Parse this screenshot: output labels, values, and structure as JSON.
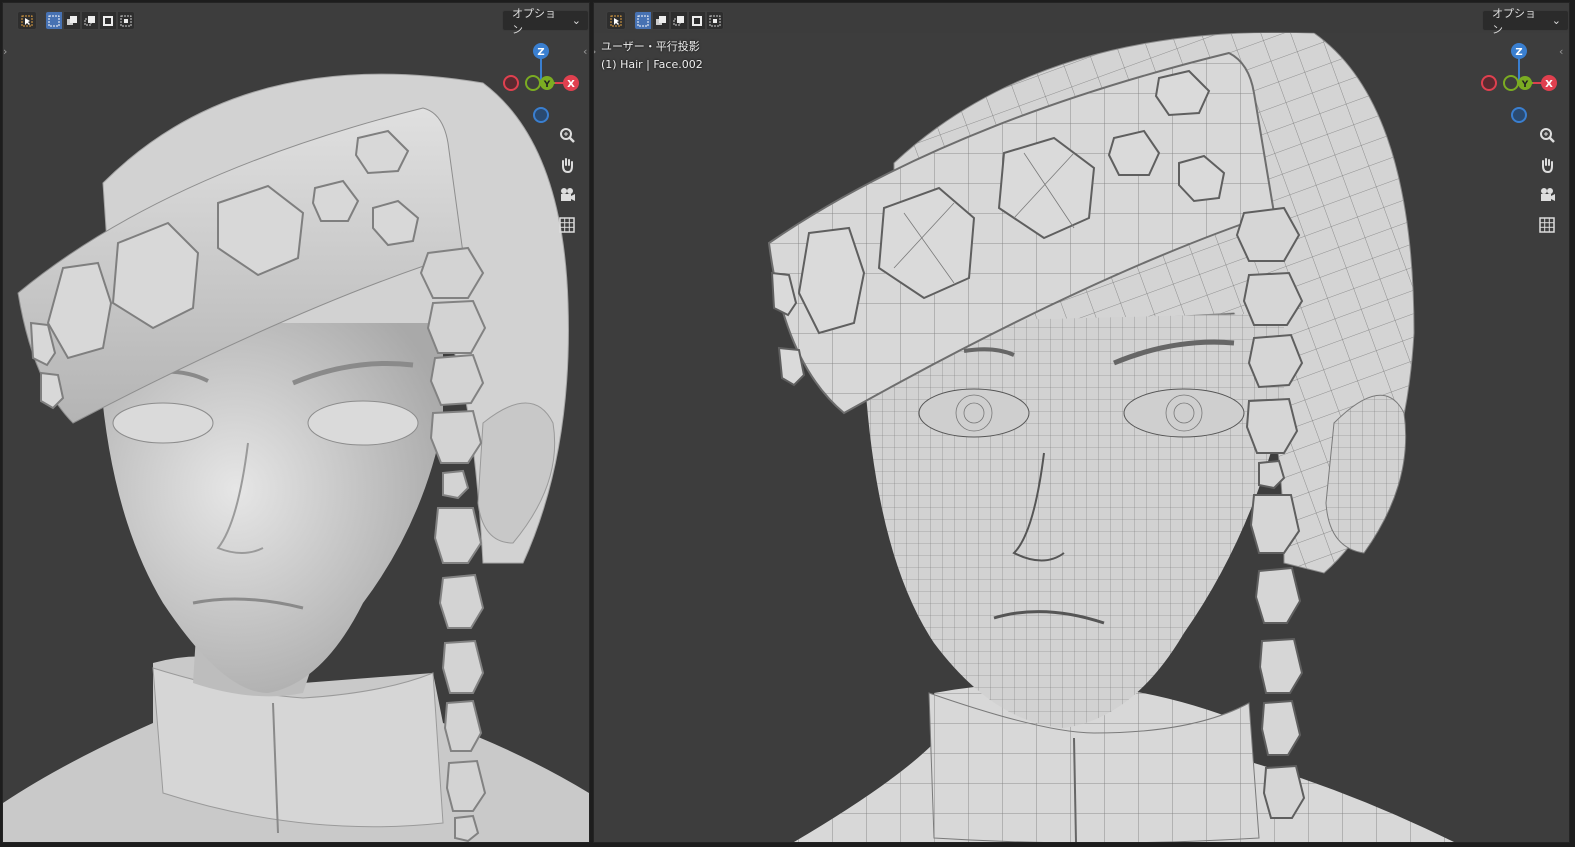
{
  "left_viewport": {
    "options_label": "オプション",
    "gizmo": {
      "z": "Z",
      "y": "Y",
      "x": "X"
    }
  },
  "right_viewport": {
    "options_label": "オプション",
    "view_name": "ユーザー・平行投影",
    "object_info": "(1) Hair | Face.002",
    "gizmo": {
      "z": "Z",
      "y": "Y",
      "x": "X"
    }
  },
  "icons": {
    "tool": "select-box-icon",
    "select_modes": [
      "new-selection-icon",
      "extend-selection-icon",
      "subtract-selection-icon",
      "invert-selection-icon",
      "intersect-selection-icon"
    ],
    "navigation": [
      "zoom-icon",
      "pan-hand-icon",
      "camera-icon",
      "grid-icon"
    ]
  },
  "colors": {
    "viewport_bg": "#3d3d3d",
    "active_select": "#4772b3",
    "axis_x": "#e0404f",
    "axis_y": "#7bac22",
    "axis_z": "#3a7fd0",
    "model": "#cfcfcf",
    "wire": "#6d6d6d"
  }
}
